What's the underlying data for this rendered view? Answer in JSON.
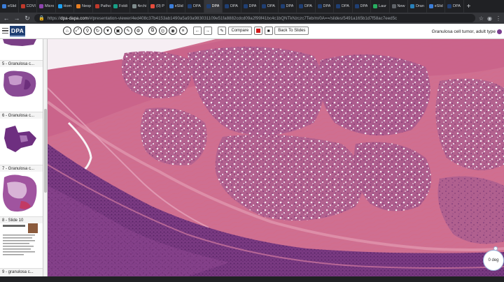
{
  "browser": {
    "tabs": [
      {
        "label": "eSlid",
        "color": "#3b7dd8"
      },
      {
        "label": "COVI",
        "color": "#c0392b"
      },
      {
        "label": "Micro",
        "color": "#8e44ad"
      },
      {
        "label": "Hom",
        "color": "#1da1f2"
      },
      {
        "label": "Neop",
        "color": "#e67e22"
      },
      {
        "label": "Patho",
        "color": "#c0392b"
      },
      {
        "label": "Foldi",
        "color": "#16a085"
      },
      {
        "label": "Archi",
        "color": "#7f8c8d"
      },
      {
        "label": "(0) P",
        "color": "#e74c3c"
      },
      {
        "label": "eSlid",
        "color": "#3b7dd8"
      },
      {
        "label": "DPA",
        "color": "#1f3f73"
      },
      {
        "label": "DPA",
        "color": "#1f3f73",
        "active": true
      },
      {
        "label": "DPA",
        "color": "#1f3f73"
      },
      {
        "label": "DPA",
        "color": "#1f3f73"
      },
      {
        "label": "DPA",
        "color": "#1f3f73"
      },
      {
        "label": "DPA",
        "color": "#1f3f73"
      },
      {
        "label": "DPA",
        "color": "#1f3f73"
      },
      {
        "label": "DPA",
        "color": "#1f3f73"
      },
      {
        "label": "DPA",
        "color": "#1f3f73"
      },
      {
        "label": "DPA",
        "color": "#1f3f73"
      },
      {
        "label": "Laur",
        "color": "#27ae60"
      },
      {
        "label": "New",
        "color": "#5f6368"
      },
      {
        "label": "Dran",
        "color": "#2980b9"
      },
      {
        "label": "eSlid",
        "color": "#3b7dd8"
      },
      {
        "label": "DPA",
        "color": "#1f3f73"
      }
    ],
    "url_host": "dpa-dapa.com",
    "url_rest": "/#/presentation-viewer/4ed408c37b4153ab1490a5a93a983031109e51fa8882cdcd09a2f99f41bc4c1bQNTkNzczc7Teb/m/0A==/slides/5491a165b1d7f58ac7eed5c",
    "url_prefix": "https://"
  },
  "toolbar": {
    "logo": "DPA",
    "compare_label": "Compare",
    "back_label": "Back To Slides",
    "case_title": "Granulosa cell tumor, adult type"
  },
  "sidebar": {
    "items": [
      {
        "label": "5 - Granulosa c...",
        "thumb": "cut"
      },
      {
        "label": "6 - Granulosa c...",
        "thumb": "strip"
      },
      {
        "label": "7 - Granulosa c...",
        "thumb": "blob"
      },
      {
        "label": "8 - Slide 10",
        "thumb": "text"
      },
      {
        "label": "9 - granulosa c...",
        "thumb": "none"
      }
    ]
  },
  "viewer": {
    "zoom_label": "0 deg"
  }
}
